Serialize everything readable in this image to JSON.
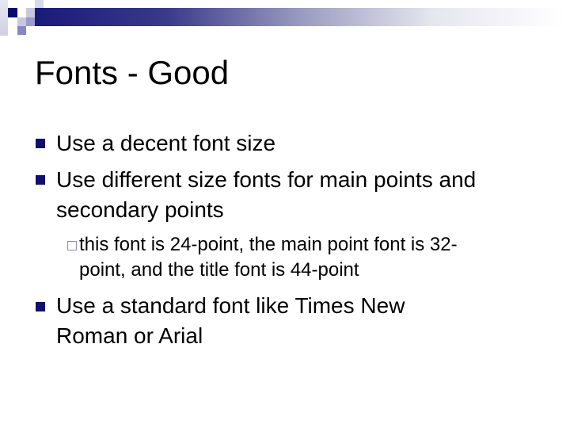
{
  "slide": {
    "title": "Fonts - Good",
    "bullets": [
      {
        "level": 1,
        "lines": [
          "Use a decent font size"
        ]
      },
      {
        "level": 1,
        "lines": [
          "Use different size fonts for main points and",
          "secondary points"
        ]
      },
      {
        "level": 2,
        "lines": [
          "this font is 24-point, the main point font is 32-",
          "point, and the title font is 44-point"
        ]
      },
      {
        "level": 1,
        "lines": [
          "Use a standard font like Times New",
          "Roman or Arial"
        ]
      }
    ]
  },
  "theme": {
    "accent": "#10106e",
    "sub_bullet": "#8c8cb8"
  }
}
